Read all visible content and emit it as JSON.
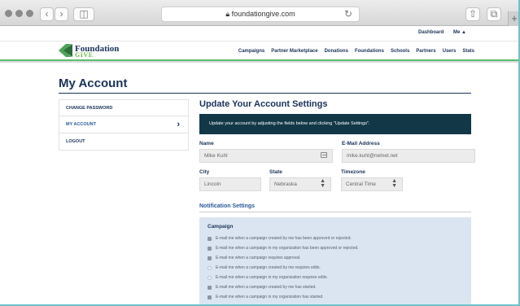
{
  "browser": {
    "url": "foundationgive.com",
    "lock_icon": "lock-icon",
    "reload_icon": "reload-icon"
  },
  "topbar": {
    "dashboard": "Dashboard",
    "me": "Me",
    "me_icon": "user-icon"
  },
  "header": {
    "logo_line1": "Foundation",
    "logo_line2": "GIVE",
    "nav": [
      "Campaigns",
      "Partner Marketplace",
      "Donations",
      "Foundations",
      "Schools",
      "Partners",
      "Users",
      "Stats"
    ]
  },
  "page": {
    "title": "My Account"
  },
  "sidebar": {
    "items": [
      {
        "label": "CHANGE PASSWORD"
      },
      {
        "label": "MY ACCOUNT"
      },
      {
        "label": "LOGOUT"
      }
    ]
  },
  "settings": {
    "heading": "Update Your Account Settings",
    "banner": "Update your account by adjusting the fields below and clicking \"Update Settings\".",
    "name_label": "Name",
    "name_value": "Mike Kuhl",
    "email_label": "E-Mail Address",
    "email_value": "mike.kuhl@nelnet.net",
    "city_label": "City",
    "city_value": "Lincoln",
    "state_label": "State",
    "state_value": "Nebraska",
    "timezone_label": "Timezone",
    "timezone_value": "Central Time"
  },
  "notifications": {
    "heading": "Notification Settings",
    "category": "Campaign",
    "options": [
      {
        "label": "E-mail me when a campaign created by me has been approved or rejected.",
        "checked": true
      },
      {
        "label": "E-mail me when a campaign in my organization has been approved or rejected.",
        "checked": true
      },
      {
        "label": "E-mail me when a campaign requires approval.",
        "checked": true
      },
      {
        "label": "E-mail me when a campaign created by me requires edits.",
        "checked": false
      },
      {
        "label": "E-mail me when a campaign in my organization requires edits.",
        "checked": false
      },
      {
        "label": "E-mail me when a campaign created by me has started.",
        "checked": true
      },
      {
        "label": "E-mail me when a campaign in my organization has started.",
        "checked": true
      }
    ]
  },
  "colors": {
    "brand_navy": "#1a3358",
    "brand_green": "#5bbf6b",
    "banner_bg": "#123847",
    "notif_bg": "#dbe5f1",
    "frame_accent": "#6fc3c9"
  }
}
